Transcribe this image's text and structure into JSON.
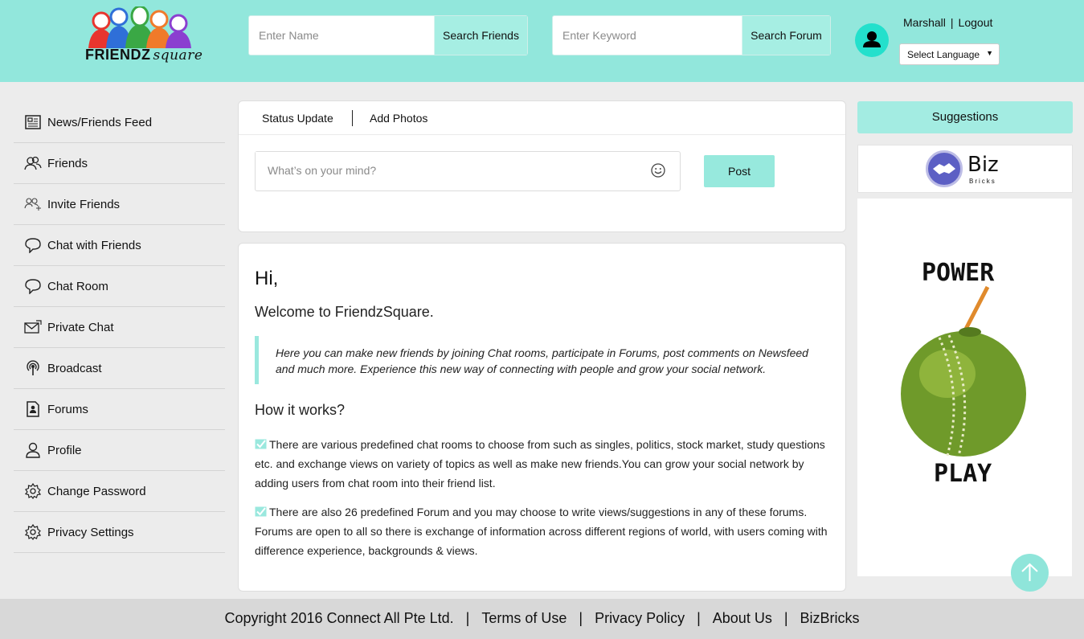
{
  "header": {
    "logo_text": "FRIENDZ",
    "logo_text_sub": "square",
    "name_search": {
      "placeholder": "Enter Name",
      "button": "Search Friends"
    },
    "forum_search": {
      "placeholder": "Enter Keyword",
      "button": "Search Forum"
    },
    "user_icon": "user-avatar-icon",
    "username": "Marshall",
    "logout": "Logout",
    "language_select": "Select Language"
  },
  "sidebar": {
    "items": [
      {
        "label": "News/Friends Feed",
        "icon": "newspaper-icon"
      },
      {
        "label": "Friends",
        "icon": "friends-icon"
      },
      {
        "label": "Invite Friends",
        "icon": "invite-icon"
      },
      {
        "label": "Chat with Friends",
        "icon": "chat-bubble-icon"
      },
      {
        "label": "Chat Room",
        "icon": "chat-bubble-icon"
      },
      {
        "label": "Private Chat",
        "icon": "private-mail-icon"
      },
      {
        "label": "Broadcast",
        "icon": "broadcast-icon"
      },
      {
        "label": "Forums",
        "icon": "forum-document-icon"
      },
      {
        "label": "Profile",
        "icon": "profile-icon"
      },
      {
        "label": "Change Password",
        "icon": "gear-icon"
      },
      {
        "label": "Privacy Settings",
        "icon": "gear-icon"
      }
    ]
  },
  "status": {
    "tab_status": "Status Update",
    "tab_photos": "Add Photos",
    "placeholder": "What’s on your mind?",
    "post_button": "Post"
  },
  "welcome": {
    "hi": "Hi,",
    "title": "Welcome to FriendzSquare.",
    "quote": "Here you can make new friends by joining Chat rooms, participate in Forums, post comments on Newsfeed and much more. Experience this new way of connecting with people and grow your social network.",
    "how_title": "How it works?",
    "point1": "There are various predefined chat rooms to choose from such as singles, politics, stock market, study questions etc. and exchange views on variety of topics as well as make new friends.You can grow your social network by adding users from chat room into their friend list.",
    "point2": "There are also 26 predefined Forum and you may choose to write views/suggestions in any of these forums. Forums are open to all so there is exchange of information across different regions of world, with users coming with difference experience, backgrounds & views."
  },
  "right": {
    "suggestions": "Suggestions",
    "biz_name": "Biz",
    "biz_sub": "Bricks",
    "ad_top": "POWER",
    "ad_bottom": "PLAY"
  },
  "footer": {
    "copyright": "Copyright 2016 Connect All Pte Ltd.",
    "terms": "Terms of Use",
    "privacy": "Privacy Policy",
    "about": "About Us",
    "bizbricks": "BizBricks"
  },
  "colors": {
    "header_bg": "#92e7dc",
    "accent": "#a6eee3",
    "avatar": "#23e0cc",
    "footer_bg": "#d8d8d8"
  }
}
